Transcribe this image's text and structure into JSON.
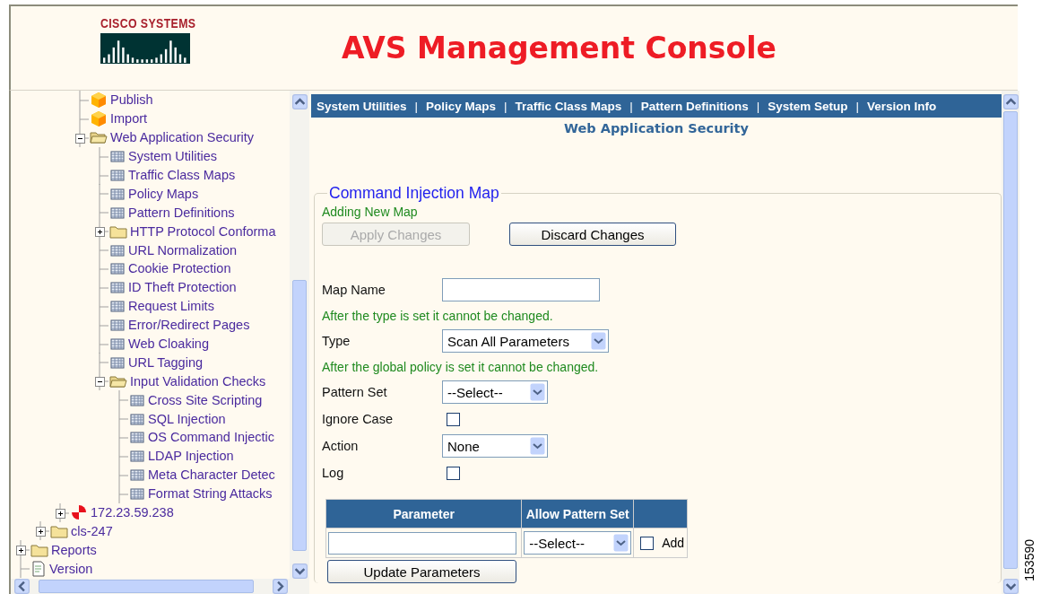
{
  "header": {
    "logo_text": "CISCO SYSTEMS",
    "title": "AVS Management Console"
  },
  "tree": [
    {
      "children": [
        {
          "children": [
            {
              "children": [
                {
                  "label": "Publish",
                  "kind": "cube"
                },
                {
                  "label": "Import",
                  "kind": "cube"
                },
                {
                  "label": "Web Application Security",
                  "kind": "folder",
                  "expanded": true,
                  "children": [
                    {
                      "label": "System Utilities",
                      "kind": "page"
                    },
                    {
                      "label": "Traffic Class Maps",
                      "kind": "page"
                    },
                    {
                      "label": "Policy Maps",
                      "kind": "page"
                    },
                    {
                      "label": "Pattern Definitions",
                      "kind": "page"
                    },
                    {
                      "label": "HTTP Protocol Conforma",
                      "kind": "folder",
                      "expanded": false
                    },
                    {
                      "label": "URL Normalization",
                      "kind": "page"
                    },
                    {
                      "label": "Cookie Protection",
                      "kind": "page"
                    },
                    {
                      "label": "ID Theft Protection",
                      "kind": "page"
                    },
                    {
                      "label": "Request Limits",
                      "kind": "page"
                    },
                    {
                      "label": "Error/Redirect Pages",
                      "kind": "page"
                    },
                    {
                      "label": "Web Cloaking",
                      "kind": "page"
                    },
                    {
                      "label": "URL Tagging",
                      "kind": "page"
                    },
                    {
                      "label": "Input Validation Checks",
                      "kind": "folder",
                      "expanded": true,
                      "children": [
                        {
                          "label": "Cross Site Scripting",
                          "kind": "page"
                        },
                        {
                          "label": "SQL Injection",
                          "kind": "page"
                        },
                        {
                          "label": "OS Command Injectic",
                          "kind": "page"
                        },
                        {
                          "label": "LDAP Injection",
                          "kind": "page"
                        },
                        {
                          "label": "Meta Character Detec",
                          "kind": "page"
                        },
                        {
                          "label": "Format String Attacks",
                          "kind": "page"
                        }
                      ]
                    }
                  ]
                }
              ]
            },
            {
              "label": "172.23.59.238",
              "kind": "server",
              "expanded": false
            }
          ]
        },
        {
          "label": "cls-247",
          "kind": "folder",
          "expanded": false
        }
      ]
    },
    {
      "label": "Reports",
      "kind": "folder",
      "expanded": false
    },
    {
      "label": "Version",
      "kind": "doc"
    }
  ],
  "nav": {
    "items": [
      "System Utilities",
      "Policy Maps",
      "Traffic Class Maps",
      "Pattern Definitions",
      "System Setup",
      "Version Info"
    ],
    "separator": "|"
  },
  "page_title": "Web Application Security",
  "form": {
    "legend": "Command Injection Map",
    "status": "Adding New Map",
    "buttons": [
      {
        "label": "Apply Changes",
        "disabled": true
      },
      {
        "label": "Discard Changes",
        "disabled": false
      }
    ],
    "rows": [
      {
        "kind": "text",
        "label": "Map Name"
      },
      {
        "kind": "note",
        "text": "After the type is set it cannot be changed."
      },
      {
        "kind": "select",
        "label": "Type",
        "value": "Scan All Parameters"
      },
      {
        "kind": "note",
        "text": "After the global policy is set it cannot be changed."
      },
      {
        "kind": "select",
        "label": "Pattern Set",
        "value": "--Select--"
      },
      {
        "kind": "checkbox",
        "label": "Ignore Case",
        "checked": false
      },
      {
        "kind": "select",
        "label": "Action",
        "value": "None"
      },
      {
        "kind": "checkbox",
        "label": "Log",
        "checked": false
      }
    ]
  },
  "params": {
    "columns": [
      "Parameter",
      "Allow Pattern Set"
    ],
    "row": {
      "select": "--Select--",
      "add_label": "Add",
      "add_checked": false
    },
    "button": "Update Parameters"
  },
  "figure_number": "153590"
}
